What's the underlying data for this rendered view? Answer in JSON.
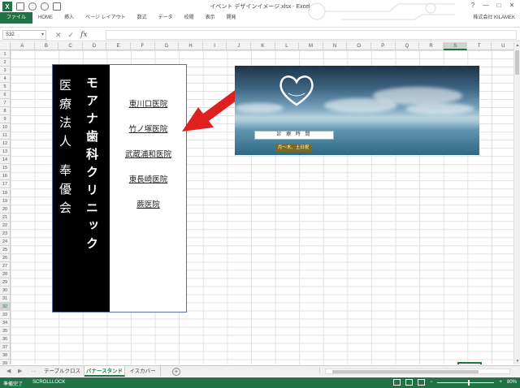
{
  "window": {
    "title": "イベント デザインイメージ.xlsx - Excel",
    "account": "株式会社 KILAMEK",
    "controls": [
      "?",
      "—",
      "□",
      "✕"
    ]
  },
  "ribbon": {
    "tabs": [
      "ファイル",
      "HOME",
      "挿入",
      "ページ レイアウト",
      "数式",
      "データ",
      "校閲",
      "表示",
      "開発"
    ]
  },
  "formula_bar": {
    "name_box": "S32",
    "fx": "fx",
    "value": ""
  },
  "grid": {
    "columns": [
      "A",
      "B",
      "C",
      "D",
      "E",
      "F",
      "G",
      "H",
      "I",
      "J",
      "K",
      "L",
      "M",
      "N",
      "O",
      "P",
      "Q",
      "R",
      "S",
      "T",
      "U"
    ],
    "selected_column": "S",
    "rows": [
      "1",
      "2",
      "3",
      "4",
      "5",
      "6",
      "7",
      "8",
      "9",
      "10",
      "11",
      "12",
      "13",
      "14",
      "15",
      "16",
      "17",
      "18",
      "19",
      "20",
      "21",
      "22",
      "23",
      "24",
      "25",
      "26",
      "27",
      "28",
      "29",
      "30",
      "31",
      "32",
      "33",
      "34",
      "35",
      "36",
      "37",
      "38",
      "39"
    ],
    "selected_row": "32",
    "active_cell": "S32"
  },
  "banner": {
    "clinic_name": "モアナ歯科クリニック",
    "corporation": "医療法人 奉優会",
    "clinics": [
      "東川口医院",
      "竹ノ塚医院",
      "武蔵浦和医院",
      "東長崎医院",
      "蕨医院"
    ]
  },
  "photo": {
    "hours_label": "診 療 時 間",
    "hours_sub": "月〜木、土日祝"
  },
  "sheet_tabs": {
    "tabs": [
      "テーブルクロス",
      "バナースタンド",
      "イスカバー"
    ],
    "active": "バナースタンド",
    "add_label": "+"
  },
  "status_bar": {
    "ready": "準備完了",
    "scroll_lock": "SCROLLLOCK",
    "zoom": "80%"
  },
  "colors": {
    "excel_green": "#217346",
    "arrow_red": "#e02020",
    "banner_black": "#000000"
  },
  "icons": [
    "excel-logo-icon",
    "save-icon",
    "undo-icon",
    "redo-icon",
    "print-icon",
    "arrow-annotation-icon",
    "heart-logo-icon",
    "add-sheet-icon"
  ]
}
